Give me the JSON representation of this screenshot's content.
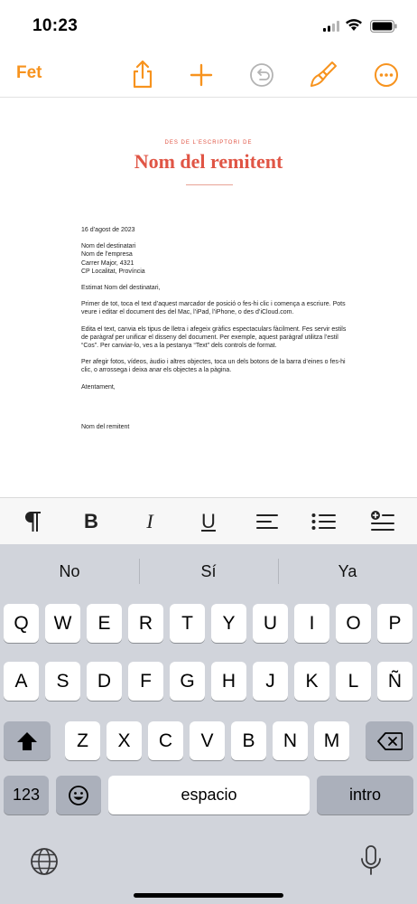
{
  "status": {
    "time": "10:23"
  },
  "toolbar": {
    "done_label": "Fet",
    "icons": [
      "share-icon",
      "add-icon",
      "undo-icon",
      "brush-icon",
      "more-icon"
    ],
    "accent": "#f7931e"
  },
  "document": {
    "eyebrow": "DES DE L’ESCRIPTORI DE",
    "sender_title": "Nom del remitent",
    "date": "16 d’agost de 2023",
    "address": [
      "Nom del destinatari",
      "Nom de l’empresa",
      "Carrer Major, 4321",
      "CP Localitat, Província"
    ],
    "salutation": "Estimat Nom del destinatari,",
    "paragraphs": [
      "Primer de tot, toca el text d’aquest marcador de posició o fes-hi clic i comença a escriure. Pots veure i editar el document des del Mac, l’iPad, l’iPhone, o des d’iCloud.com.",
      "Edita el text, canvia els tipus de lletra i afegeix gràfics espectaculars fàcilment. Fes servir estils de paràgraf per unificar el disseny del document. Per exemple, aquest paràgraf utilitza l’estil “Cos”. Per canviar-lo, ves a la pestanya “Text” dels controls de format.",
      "Per afegir fotos, vídeos, àudio i altres objectes, toca un dels botons de la barra d’eines o fes-hi clic, o arrossega i deixa anar els objectes a la pàgina."
    ],
    "closing": "Atentament,",
    "signature": "Nom del remitent",
    "accent": "#e05545"
  },
  "format_bar": {
    "bold": "B",
    "italic": "I",
    "underline": "U",
    "icons": [
      "paragraph-icon",
      "bold-icon",
      "italic-icon",
      "underline-icon",
      "align-icon",
      "list-icon",
      "insert-icon"
    ]
  },
  "keyboard": {
    "suggestions": [
      "No",
      "Sí",
      "Ya"
    ],
    "row1": [
      "Q",
      "W",
      "E",
      "R",
      "T",
      "Y",
      "U",
      "I",
      "O",
      "P"
    ],
    "row2": [
      "A",
      "S",
      "D",
      "F",
      "G",
      "H",
      "J",
      "K",
      "L",
      "Ñ"
    ],
    "row3": [
      "Z",
      "X",
      "C",
      "V",
      "B",
      "N",
      "M"
    ],
    "numbers_label": "123",
    "space_label": "espacio",
    "return_label": "intro"
  }
}
